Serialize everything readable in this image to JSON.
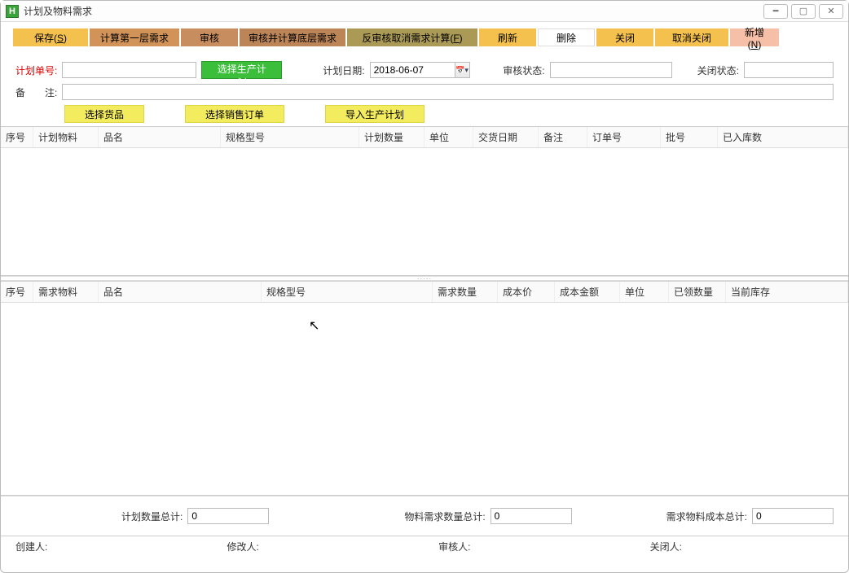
{
  "window": {
    "icon_letter": "H",
    "title": "计划及物料需求"
  },
  "toolbar": {
    "save": "保存(S)",
    "calc_first": "计算第一层需求",
    "audit": "审核",
    "audit_calc_bottom": "审核并计算底层需求",
    "unaudit_cancel": "反审核取消需求计算(F)",
    "refresh": "刷新",
    "delete": "删除",
    "close": "关闭",
    "cancel_close": "取消关闭",
    "new": "新增(N)"
  },
  "form": {
    "plan_no_label": "计划单号:",
    "select_plan_btn": "选择生产计划",
    "plan_date_label": "计划日期:",
    "plan_date_value": "2018-06-07",
    "audit_status_label": "审核状态:",
    "close_status_label": "关闭状态:",
    "remark_label": "备　　注:"
  },
  "subbtns": {
    "select_goods": "选择货品",
    "select_sales": "选择销售订单",
    "import_plan": "导入生产计划"
  },
  "grid1": {
    "cols": [
      "序号",
      "计划物料",
      "品名",
      "规格型号",
      "计划数量",
      "单位",
      "交货日期",
      "备注",
      "订单号",
      "批号",
      "已入库数"
    ]
  },
  "grid2": {
    "cols": [
      "序号",
      "需求物料",
      "品名",
      "规格型号",
      "需求数量",
      "成本价",
      "成本金额",
      "单位",
      "已领数量",
      "当前库存"
    ]
  },
  "totals": {
    "plan_qty_label": "计划数量总计:",
    "plan_qty_value": "0",
    "req_qty_label": "物料需求数量总计:",
    "req_qty_value": "0",
    "req_cost_label": "需求物料成本总计:",
    "req_cost_value": "0"
  },
  "status": {
    "creator": "创建人:",
    "modifier": "修改人:",
    "auditor": "审核人:",
    "closer": "关闭人:"
  }
}
